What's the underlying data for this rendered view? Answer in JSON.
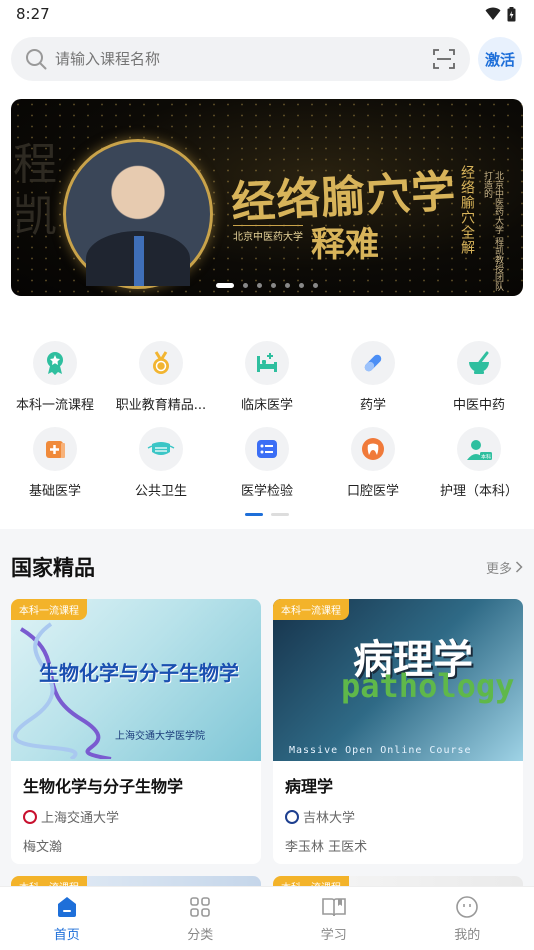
{
  "status": {
    "time": "8:27"
  },
  "search": {
    "placeholder": "请输入课程名称",
    "activate_label": "激活"
  },
  "banner": {
    "left_chars": "程\n凯",
    "title": "经络腧穴学",
    "subtitle": "释难",
    "school": "北京中医药大学",
    "vertical_1": "经络腧穴全解",
    "vertical_2": "北京中医药大学 程凯教授团队打造的",
    "slides": 7,
    "active_slide": 0
  },
  "categories": [
    {
      "label": "本科一流课程",
      "icon": "award-icon",
      "color": "#2fbf9f"
    },
    {
      "label": "职业教育精品...",
      "icon": "medal-icon",
      "color": "#f2b531"
    },
    {
      "label": "临床医学",
      "icon": "hospital-bed-icon",
      "color": "#2fbf9f"
    },
    {
      "label": "药学",
      "icon": "capsule-icon",
      "color": "#4b8ef5"
    },
    {
      "label": "中医中药",
      "icon": "mortar-icon",
      "color": "#2fbf9f"
    },
    {
      "label": "基础医学",
      "icon": "first-aid-icon",
      "color": "#f08a3a"
    },
    {
      "label": "公共卫生",
      "icon": "mask-icon",
      "color": "#3bc6c6"
    },
    {
      "label": "医学检验",
      "icon": "test-report-icon",
      "color": "#3b6ef5"
    },
    {
      "label": "口腔医学",
      "icon": "tooth-icon",
      "color": "#f07a3a"
    },
    {
      "label": "护理（本科）",
      "icon": "nurse-icon",
      "color": "#2fbf9f"
    }
  ],
  "section": {
    "title": "国家精品",
    "more_label": "更多"
  },
  "courses": [
    {
      "tag": "本科一流课程",
      "cover_title": "生物化学与分子生物学",
      "cover_school": "上海交通大学医学院",
      "title": "生物化学与分子生物学",
      "school": "上海交通大学",
      "teacher": "梅文瀚",
      "logo_color": "#c8102e"
    },
    {
      "tag": "本科一流课程",
      "cover_title": "病理学",
      "cover_en": "pathology",
      "cover_mooc": "Massive Open Online Course",
      "title": "病理学",
      "school": "吉林大学",
      "teacher": "李玉林 王医术",
      "logo_color": "#1d3f8f"
    }
  ],
  "next_row_tags": [
    "本科一流课程",
    "本科一流课程"
  ],
  "tabs": [
    {
      "label": "首页",
      "icon": "home-icon",
      "active": true
    },
    {
      "label": "分类",
      "icon": "grid-icon",
      "active": false
    },
    {
      "label": "学习",
      "icon": "book-icon",
      "active": false
    },
    {
      "label": "我的",
      "icon": "profile-icon",
      "active": false
    }
  ],
  "colors": {
    "accent": "#1e6fd9",
    "tag": "#f3b32a"
  }
}
